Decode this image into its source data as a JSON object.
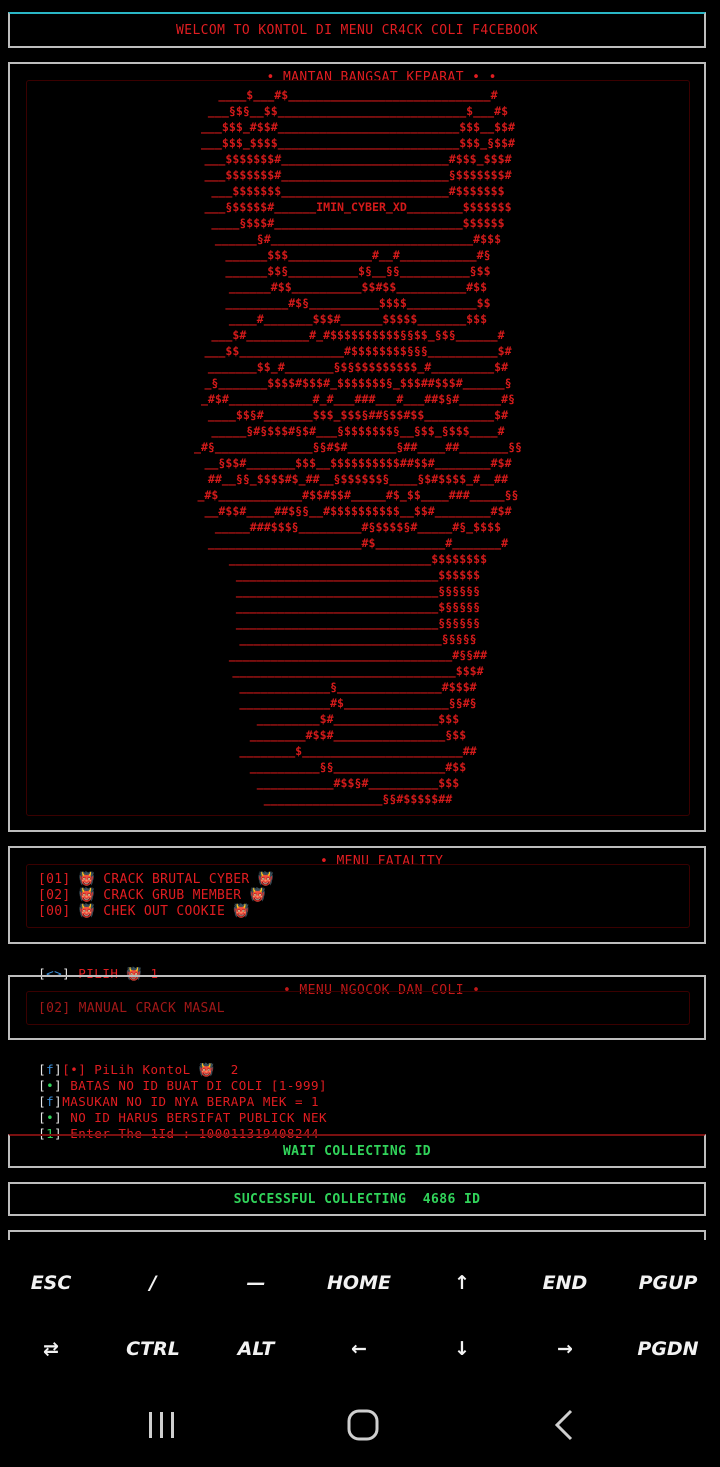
{
  "terminal": {
    "title": "WELCOM TO KONTOL DI MENU CR4CK COLI F4CEBOOK",
    "banner_legend": "• MANTAN BANGSAT KEPARAT • •",
    "ascii_art": "____$___#$_____________________________#\n___§$§__$$___________________________$___#$\n___$$$_#$$#__________________________$$$__$$#\n___$$$_$$$$__________________________$$$_§$$#\n___$$$$$$$#________________________#$$$_$$$#\n___$$$$$$$#________________________§$$$$$$$#\n___$$$$$$$________________________#$$$$$$$\n___§$$$$$#______IMIN_CYBER_XD________$$$$$$$\n____§$$$#___________________________$$$$$$\n______§#_____________________________#$$$\n______$$$____________#__#___________#§\n______$$§__________$§__§§__________§$$\n______#$$__________$$#$$__________#$$\n_________#$§__________$$$$__________$$\n____#_______$$$#______$$$$$_______$$$\n___$#_________#_#$$$$$$$$$$§§$$_§$§______#\n___$$_______________#$$$$$$$$§§§__________$#\n_______$$_#_______§$§$$$$$$$$$_#_________$#\n_§_______$$$$#$$$#_$$$$$$$§_$$$##$$$#______§\n_#$#____________#_#___###___#___##$§#______#§\n____$$§#_______$$$_$$$§##§$$#$$__________$#\n_____§#§$$$#§$#___§$$$$$$$§__§$$_§$$$____#\n_#§______________§§#$#_______§##____##_______§§\n__§$$#_______$$$__$$$$$$$$$$##$$#________#$#\n##__§§_$$$$#$_##__§$$$$$$§____§$#$$$$_#__##\n_#$____________#$$#$$#_____#$_$$____###_____§§\n__#$$#____##$§§__#$$$$$$$$$$__$$#________#$#\n_____###$$$§_________#§$$$$§#_____#§_$$$$\n______________________#$__________#_______#\n_____________________________$$$$$$$$\n_____________________________$$$$$$\n_____________________________§§§§§§\n_____________________________$§§§§§\n_____________________________§§§§§§\n_____________________________§§§§§\n________________________________#§§##\n________________________________$$$#\n_____________§_______________#$$$#\n_____________#$_______________§§#§\n_________$#_______________$$$\n________#$$#________________§$$\n________$_______________________##\n__________§§________________#$$\n___________#$$§#__________$$$\n_________________§§#$$$$$##",
    "menu_legend": "• MENU FATALITY",
    "menu_items": [
      "[01] 👹 CRACK BRUTAL CYBER 👹",
      "[02] 👹 CRACK GRUB MEMBER 👹",
      "[00] 👹 CHEK OUT COOKIE 👹"
    ],
    "prompt_pilih": {
      "bracket": "[<>]",
      "label": " PILIH 👹 1"
    },
    "sub_legend": "• MENU NGOCOK DAN COLI •",
    "sub_item": "[02] MANUAL CRACK MASAL",
    "log_lines": [
      {
        "prefix": "[f]",
        "prefix2": "[•]",
        "text": " PiLih KontoL 👹  2"
      },
      {
        "prefix": "[•]",
        "prefix2": "",
        "text": " BATAS NO ID BUAT DI COLI [1-999]"
      },
      {
        "prefix": "[f]",
        "prefix2": "",
        "text": "MASUKAN NO ID NYA BERAPA MEK = 1"
      },
      {
        "prefix": "[•]",
        "prefix2": "",
        "text": " NO ID HARUS BERSIFAT PUBLICK NEK"
      },
      {
        "prefix": "[1]",
        "prefix2": "",
        "text": " Enter The 1Id : 100011319408244"
      }
    ],
    "status_wait": "WAIT COLLECTING ID",
    "status_success": "SUCCESSFUL COLLECTING  4686 ID"
  },
  "extra_keys": {
    "row1": [
      "ESC",
      "/",
      "—",
      "HOME",
      "↑",
      "END",
      "PGUP"
    ],
    "row2": [
      "⇄",
      "CTRL",
      "ALT",
      "←",
      "↓",
      "→",
      "PGDN"
    ]
  },
  "navbar": {
    "recents": "recents-icon",
    "home": "home-icon",
    "back": "back-icon"
  },
  "colors": {
    "background": "#000000",
    "terminal_red": "#e11d21",
    "success_green": "#31d35a",
    "border_gray": "#bdbdbd",
    "accent_cyan": "#2ab7c6"
  }
}
